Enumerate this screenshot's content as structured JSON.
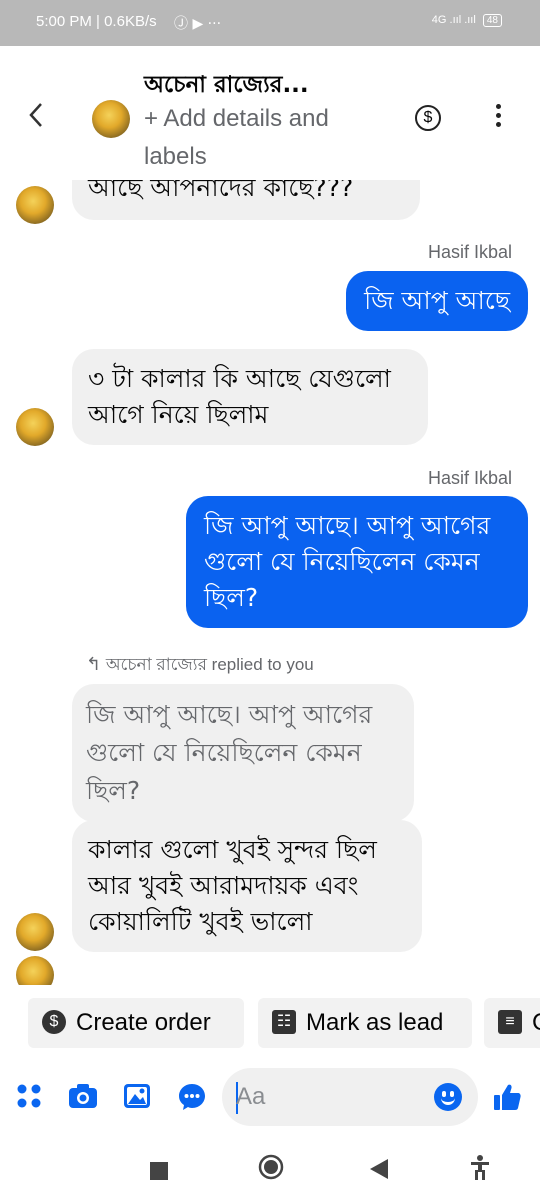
{
  "status_bar": {
    "time_speed": "5:00 PM | 0.6KB/s",
    "extra_icons": "Ⓙ ▶ ···",
    "signal": "4G .ııl .ııl",
    "battery": "48"
  },
  "header": {
    "title": "অচেনা রাজ্যের...",
    "subtitle": "+ Add details and labels",
    "dollar_symbol": "$"
  },
  "messages": [
    {
      "direction": "in",
      "text": "আছে আপনাদের কাছে???"
    },
    {
      "direction": "out",
      "sender": "Hasif Ikbal",
      "text": "জি আপু আছে"
    },
    {
      "direction": "in",
      "text": "৩ টা কালার কি আছে যেগুলো আগে নিয়ে ছিলাম"
    },
    {
      "direction": "out",
      "sender": "Hasif Ikbal",
      "text": "জি আপু আছে। আপু আগের গুলো যে নিয়েছিলেন কেমন ছিল?"
    },
    {
      "direction": "in",
      "reply_note": "অচেনা রাজ্যের replied to you",
      "quoted": "জি আপু আছে। আপু আগের গুলো যে নিয়েছিলেন কেমন ছিল?",
      "text": "কালার গুলো খুবই সুন্দর ছিল আর খুবই আরামদায়ক এবং কোয়ালিটি খুবই ভালো"
    }
  ],
  "quick_actions": [
    {
      "label": "Create order",
      "icon": "dollar-icon",
      "glyph": "$"
    },
    {
      "label": "Mark as lead",
      "icon": "contact-card-icon",
      "glyph": "☷"
    },
    {
      "label": "C",
      "icon": "invoice-icon",
      "glyph": "≡"
    }
  ],
  "composer": {
    "placeholder": "Aa"
  },
  "colors": {
    "outgoing_bubble": "#0a62f0",
    "incoming_bubble": "#f0f0f0",
    "accent": "#0a66f0"
  }
}
